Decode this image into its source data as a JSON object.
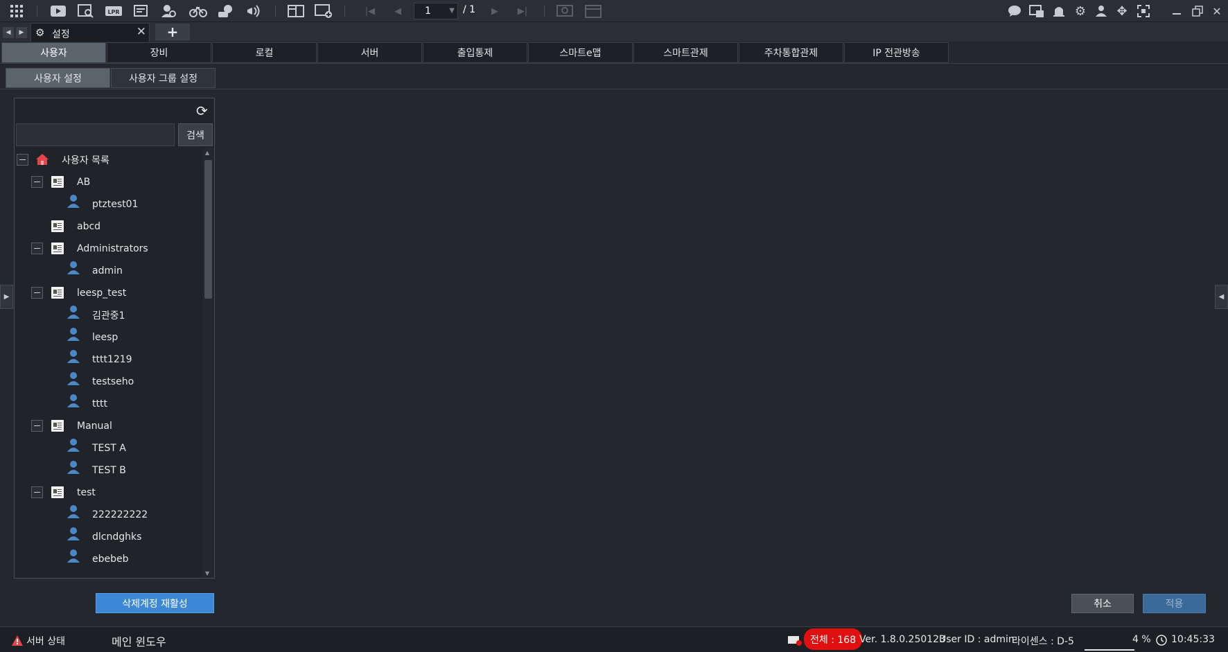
{
  "toolbar": {
    "page_current": "1",
    "page_total": "/ 1",
    "left_icons": [
      "grid-icon",
      "play-icon",
      "search-playback-icon",
      "lpr-icon",
      "event-search-icon",
      "face-search-icon",
      "bike-icon",
      "object-search-icon",
      "broadcast-icon"
    ],
    "right_icons": [
      "chat-icon",
      "message-icon",
      "alarm-icon",
      "settings-icon",
      "user-icon",
      "move-icon",
      "fullscreen-icon",
      "minimize-icon",
      "restore-icon",
      "close-icon"
    ]
  },
  "tabstrip": {
    "doc_tab_label": "설정",
    "add_tab_label": "+"
  },
  "main_tabs": [
    {
      "label": "사용자",
      "active": true
    },
    {
      "label": "장비"
    },
    {
      "label": "로컬"
    },
    {
      "label": "서버"
    },
    {
      "label": "출입통제"
    },
    {
      "label": "스마트e맵"
    },
    {
      "label": "스마트관제"
    },
    {
      "label": "주차통합관제"
    },
    {
      "label": "IP 전관방송"
    }
  ],
  "sub_tabs": [
    {
      "label": "사용자 설정",
      "active": true
    },
    {
      "label": "사용자 그룹 설정"
    }
  ],
  "search": {
    "button_label": "검색",
    "value": ""
  },
  "tree": {
    "root_label": "사용자 목록",
    "groups": [
      {
        "label": "AB",
        "users": [
          "ptztest01"
        ]
      },
      {
        "label": "abcd",
        "users": []
      },
      {
        "label": "Administrators",
        "users": [
          "admin"
        ]
      },
      {
        "label": "leesp_test",
        "users": [
          "김관중1",
          "leesp",
          "tttt1219",
          "testseho",
          "tttt"
        ]
      },
      {
        "label": "Manual",
        "users": [
          "TEST A",
          "TEST B"
        ]
      },
      {
        "label": "test",
        "users": [
          "222222222",
          "dlcndghks",
          "ebebeb"
        ]
      }
    ]
  },
  "buttons": {
    "restore_deleted": "삭제계정 재활성",
    "cancel": "취소",
    "apply": "적용"
  },
  "statusbar": {
    "server_status": "서버 상태",
    "main_window": "메인 윈도우",
    "total": "전체 : 168",
    "version": "Ver. 1.8.0.250123",
    "user_id": "User ID : admin",
    "license": "라이센스 : D-5",
    "cpu": "4 %",
    "time": "10:45:33"
  },
  "colors": {
    "background": "#24282e",
    "accent": "#3c87d6",
    "alert": "#e01010",
    "user_icon": "#4a88c8"
  }
}
